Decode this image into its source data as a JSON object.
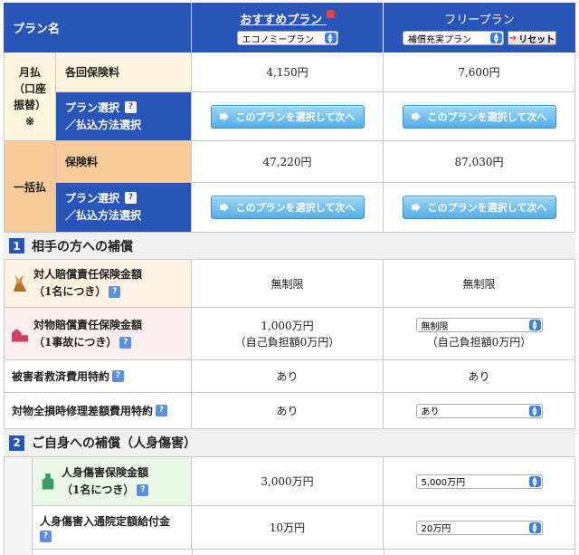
{
  "header": {
    "plan_name": "プラン名",
    "recommended": "おすすめプラン",
    "free": "フリープラン",
    "recommended_select": "エコノミープラン",
    "free_select": "補償充実プラン",
    "reset": "リセット"
  },
  "monthly": {
    "label": "月払\n（口座\n振替）\n※",
    "premium_label": "各回保険料",
    "premium_rec": "4,150円",
    "premium_free": "7,600円",
    "select_label": "プラン選択\n／払込方法選択"
  },
  "lump": {
    "label": "一括払",
    "premium_label": "保険料",
    "premium_rec": "47,220円",
    "premium_free": "87,030円",
    "select_label": "プラン選択\n／払込方法選択"
  },
  "select_button": "このプランを選択して次へ",
  "sec1": {
    "num": "1",
    "title": "相手の方への補償"
  },
  "bodily": {
    "label": "対人賠償責任保険金額",
    "sub": "（1名につき）",
    "rec": "無制限",
    "free": "無制限"
  },
  "property": {
    "label": "対物賠償責任保険金額",
    "sub": "（1事故につき）",
    "rec": "1,000万円",
    "rec_sub": "（自己負担額0万円）",
    "free_select": "無制限",
    "free_sub": "（自己負担額0万円）"
  },
  "victim": {
    "label": "被害者救済費用特約",
    "rec": "あり",
    "free": "あり"
  },
  "repair": {
    "label": "対物全損時修理差額費用特約",
    "rec": "あり",
    "free_select": "あり"
  },
  "sec2": {
    "num": "2",
    "title": "ご自身への補償（人身傷害）"
  },
  "injury": {
    "label": "人身傷害保険金額",
    "sub": "（1名につき）",
    "rec": "3,000万円",
    "free_select": "5,000万円"
  },
  "hospital": {
    "label": "人身傷害入通院定額給付金",
    "rec": "10万円",
    "free_select": "20万円"
  }
}
